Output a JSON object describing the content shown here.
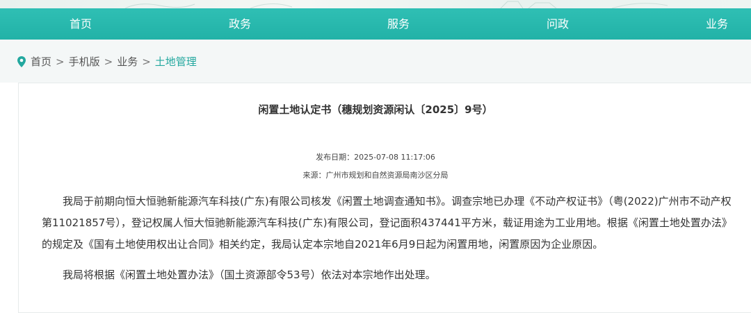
{
  "nav": {
    "items": [
      {
        "label": "首页"
      },
      {
        "label": "政务"
      },
      {
        "label": "服务"
      },
      {
        "label": "问政"
      },
      {
        "label": "业务"
      }
    ]
  },
  "breadcrumb": {
    "items": [
      "首页",
      "手机版",
      "业务"
    ],
    "separator": ">",
    "current": "土地管理"
  },
  "article": {
    "title": "闲置土地认定书（穗规划资源闲认〔2025〕9号）",
    "publish_date": "发布日期：2025-07-08 11:17:06",
    "source": "来源：广州市规划和自然资源局南沙区分局",
    "paragraph1_lines": [
      "我局于前期向恒大恒驰新能源汽车科技(广东)有限公司核发《闲置土地调查通知书》。调查宗地已办理《不动产权证书》（粤(2022)广州市不动产权",
      "第11021857号），登记权属人恒大恒驰新能源汽车科技(广东)有限公司，登记面积437441平方米，载证用途为工业用地。根据《闲置土地处置办法》",
      "的规定及《国有土地使用权出让合同》相关约定，我局认定本宗地自2021年6月9日起为闲置用地，闲置原因为企业原因。"
    ],
    "paragraph2": "我局将根据《闲置土地处置办法》（国土资源部令53号）依法对本宗地作出处理。"
  },
  "colors": {
    "nav_bg": "#22b2a7",
    "accent": "#23a89f",
    "crumb_bg": "#f4f7f7"
  }
}
